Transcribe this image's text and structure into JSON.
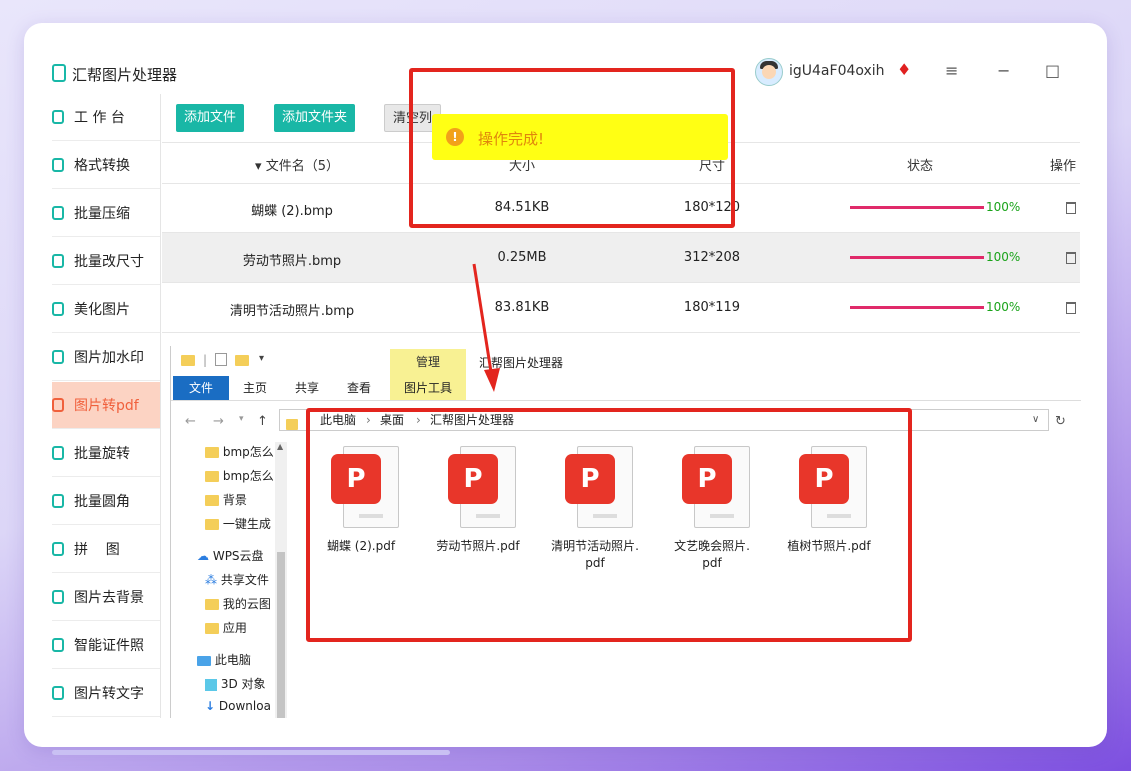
{
  "app": {
    "title": "汇帮图片处理器",
    "username": "igU4aF04oxih",
    "vip_icon": "diamond-icon",
    "window_controls": {
      "menu": "≡",
      "minimize": "−",
      "maximize": "□"
    }
  },
  "sidebar": {
    "items": [
      {
        "label": "工 作 台",
        "icon": "dashboard-icon"
      },
      {
        "label": "格式转换",
        "icon": "convert-icon"
      },
      {
        "label": "批量压缩",
        "icon": "compress-icon"
      },
      {
        "label": "批量改尺寸",
        "icon": "resize-icon"
      },
      {
        "label": "美化图片",
        "icon": "beautify-icon"
      },
      {
        "label": "图片加水印",
        "icon": "watermark-icon"
      },
      {
        "label": "图片转pdf",
        "icon": "pdf-icon",
        "active": true
      },
      {
        "label": "批量旋转",
        "icon": "rotate-icon"
      },
      {
        "label": "批量圆角",
        "icon": "round-corner-icon"
      },
      {
        "label": "拼    图",
        "icon": "puzzle-icon"
      },
      {
        "label": "图片去背景",
        "icon": "remove-bg-icon"
      },
      {
        "label": "智能证件照",
        "icon": "id-photo-icon"
      },
      {
        "label": "图片转文字",
        "icon": "ocr-icon"
      }
    ]
  },
  "toolbar": {
    "add_file": "添加文件",
    "add_folder": "添加文件夹",
    "clear_list": "清空列"
  },
  "table": {
    "headers": {
      "name": "▾ 文件名（5）",
      "size": "大小",
      "dims": "尺寸",
      "status": "状态",
      "ops": "操作"
    },
    "rows": [
      {
        "name": "蝴蝶 (2).bmp",
        "size": "84.51KB",
        "dims": "180*120",
        "progress": 100,
        "pct": "100%"
      },
      {
        "name": "劳动节照片.bmp",
        "size": "0.25MB",
        "dims": "312*208",
        "progress": 100,
        "pct": "100%",
        "selected": true
      },
      {
        "name": "清明节活动照片.bmp",
        "size": "83.81KB",
        "dims": "180*119",
        "progress": 100,
        "pct": "100%"
      }
    ]
  },
  "toast": {
    "icon": "!",
    "text": "操作完成!"
  },
  "explorer": {
    "title": "汇帮图片处理器",
    "manage": "管理",
    "tabs": [
      "文件",
      "主页",
      "共享",
      "查看"
    ],
    "picture_tools": "图片工具",
    "address": {
      "parts": [
        "此电脑",
        "桌面",
        "汇帮图片处理器"
      ],
      "sep": "›"
    },
    "tree": [
      {
        "label": "bmp怎么",
        "type": "folder"
      },
      {
        "label": "bmp怎么",
        "type": "folder"
      },
      {
        "label": "背景",
        "type": "folder"
      },
      {
        "label": "一键生成",
        "type": "folder"
      },
      {
        "label": "WPS云盘",
        "type": "cloud"
      },
      {
        "label": "共享文件",
        "type": "share"
      },
      {
        "label": "我的云图",
        "type": "folder"
      },
      {
        "label": "应用",
        "type": "folder"
      },
      {
        "label": "此电脑",
        "type": "pc"
      },
      {
        "label": "3D 对象",
        "type": "3d"
      },
      {
        "label": "Downloa",
        "type": "download"
      }
    ],
    "files": [
      {
        "name": "蝴蝶 (2).pdf"
      },
      {
        "name": "劳动节照片.pdf"
      },
      {
        "name": "清明节活动照片.pdf",
        "line1": "清明节活动照片.",
        "line2": "pdf"
      },
      {
        "name": "文艺晚会照片.pdf",
        "line1": "文艺晚会照片.",
        "line2": "pdf"
      },
      {
        "name": "植树节照片.pdf"
      }
    ]
  },
  "colors": {
    "accent": "#19b7a6",
    "active_bg": "#fcd3c3",
    "active_text": "#f0603c",
    "highlight_red": "#e3251e",
    "toast_bg": "#ffff14",
    "progress": "#e02a6a"
  }
}
